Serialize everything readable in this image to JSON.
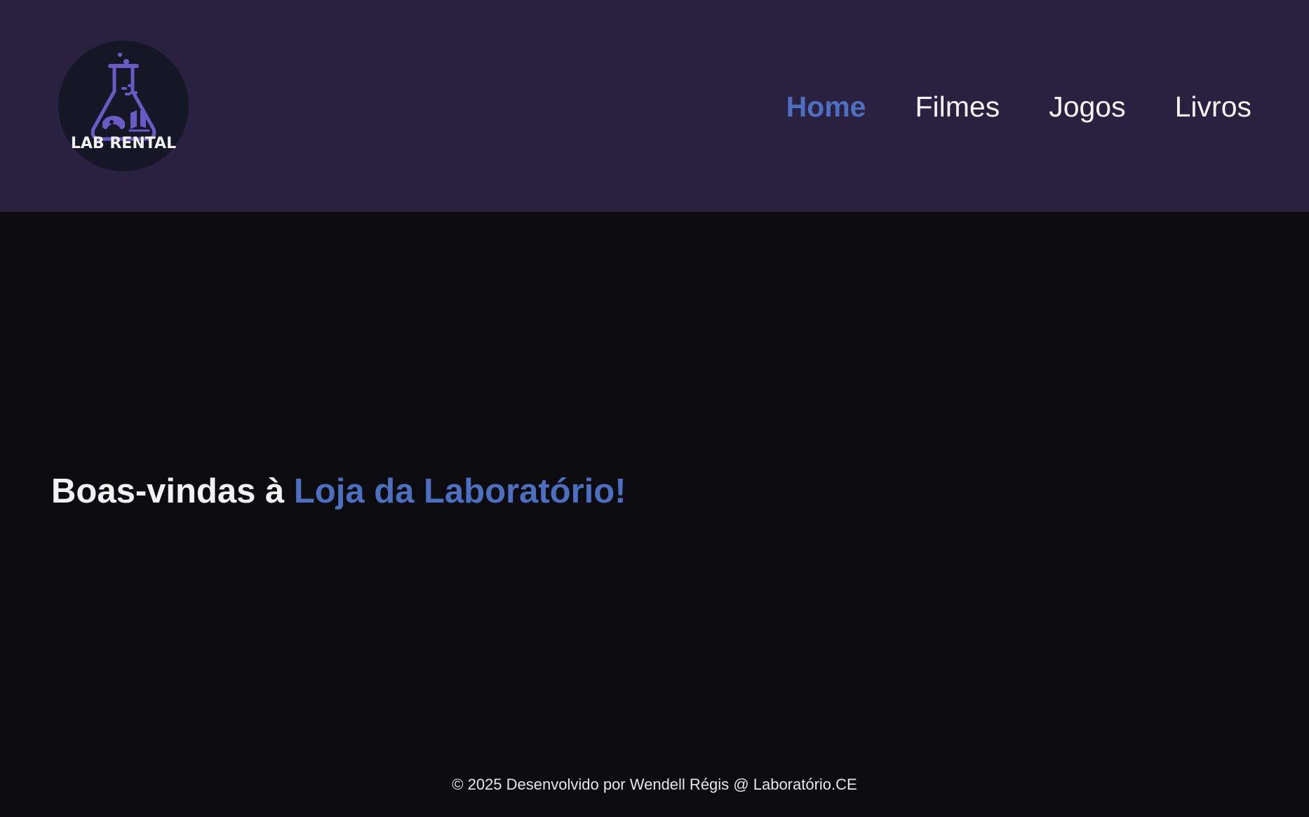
{
  "logo": {
    "text": "LAB RENTAL",
    "icon": "lab-flask-icon"
  },
  "nav": {
    "items": [
      {
        "label": "Home",
        "active": true
      },
      {
        "label": "Filmes",
        "active": false
      },
      {
        "label": "Jogos",
        "active": false
      },
      {
        "label": "Livros",
        "active": false
      }
    ]
  },
  "hero": {
    "prefix": "Boas-vindas à",
    "highlight": "Loja da Laboratório!"
  },
  "footer": {
    "text": "© 2025 Desenvolvido por Wendell Régis @ Laboratório.CE"
  },
  "colors": {
    "header_bg": "#2a2140",
    "page_bg": "#0b0b10",
    "accent": "#4e6fc0",
    "logo_bg": "#151727",
    "flask_purple": "#6a5ac4"
  }
}
